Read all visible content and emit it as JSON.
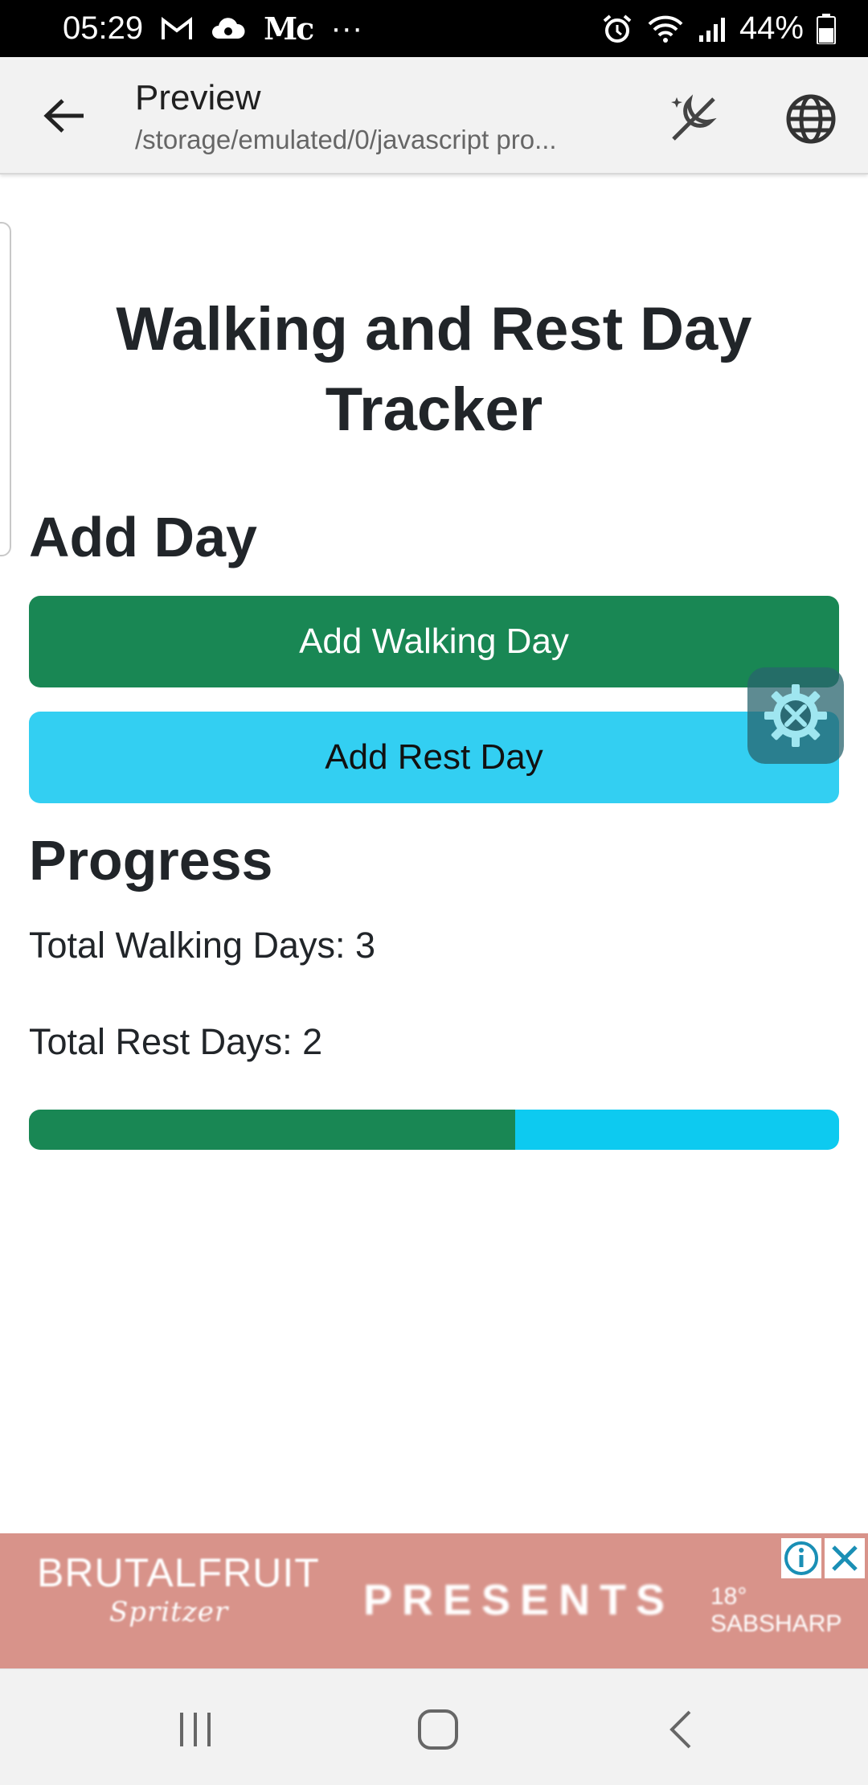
{
  "status_bar": {
    "time": "05:29",
    "notif_text": "Mc",
    "more": "···",
    "battery": "44%"
  },
  "app_bar": {
    "title": "Preview",
    "subtitle": "/storage/emulated/0/javascript pro..."
  },
  "page": {
    "heading": "Walking and Rest Day Tracker",
    "add_day_heading": "Add Day",
    "add_walking_label": "Add Walking Day",
    "add_rest_label": "Add Rest Day",
    "progress_heading": "Progress",
    "total_walking_text": "Total Walking Days: 3",
    "total_rest_text": "Total Rest Days: 2",
    "progress": {
      "walking_days": 3,
      "rest_days": 2,
      "walking_color": "#198754",
      "rest_color": "#0dcaf0"
    }
  },
  "ad": {
    "brand": "BRUTALFRUIT",
    "brand_sub": "Spritzer",
    "headline": "PRESENTS",
    "sponsor": "18° SABSHARP"
  },
  "colors": {
    "status_bar": "#000000",
    "app_bar": "#f2f2f2",
    "success": "#198754",
    "info": "#33cff2",
    "ad_background": "#d8938a",
    "ad_icon": "#1a8fb5"
  },
  "icons": {
    "back": "arrow-left-icon",
    "theme": "night-mode-icon",
    "globe": "globe-icon",
    "gear": "settings-tools-icon",
    "ad_info": "info-icon",
    "ad_close": "close-icon",
    "nav_recents": "recents-icon",
    "nav_home": "home-icon",
    "nav_back": "chevron-left-icon"
  }
}
